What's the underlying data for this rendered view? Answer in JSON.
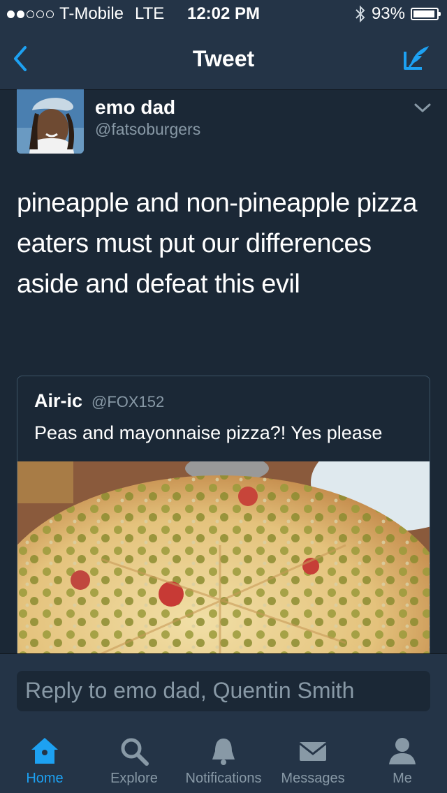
{
  "status_bar": {
    "carrier": "T-Mobile",
    "network": "LTE",
    "time": "12:02 PM",
    "battery_percent": "93%",
    "battery_level": 0.93,
    "signal_bars": 2
  },
  "nav": {
    "title": "Tweet",
    "back_icon": "chevron-left-icon",
    "compose_icon": "compose-icon"
  },
  "tweet": {
    "author_name": "emo dad",
    "author_handle": "@fatsoburgers",
    "text": "pineapple and non-pineapple pizza eaters must put our differences aside and defeat this evil"
  },
  "quote": {
    "author_name": "Air-ic",
    "author_handle": "@FOX152",
    "text": "Peas and mayonnaise pizza?! Yes please"
  },
  "reply": {
    "placeholder": "Reply to emo dad, Quentin Smith"
  },
  "tabs": [
    {
      "label": "Home",
      "icon": "home-icon",
      "active": true
    },
    {
      "label": "Explore",
      "icon": "search-icon",
      "active": false
    },
    {
      "label": "Notifications",
      "icon": "bell-icon",
      "active": false
    },
    {
      "label": "Messages",
      "icon": "envelope-icon",
      "active": false
    },
    {
      "label": "Me",
      "icon": "person-icon",
      "active": false
    }
  ],
  "colors": {
    "background": "#1b2836",
    "bar": "#243447",
    "accent": "#1da1f2",
    "muted": "#8899a6"
  }
}
